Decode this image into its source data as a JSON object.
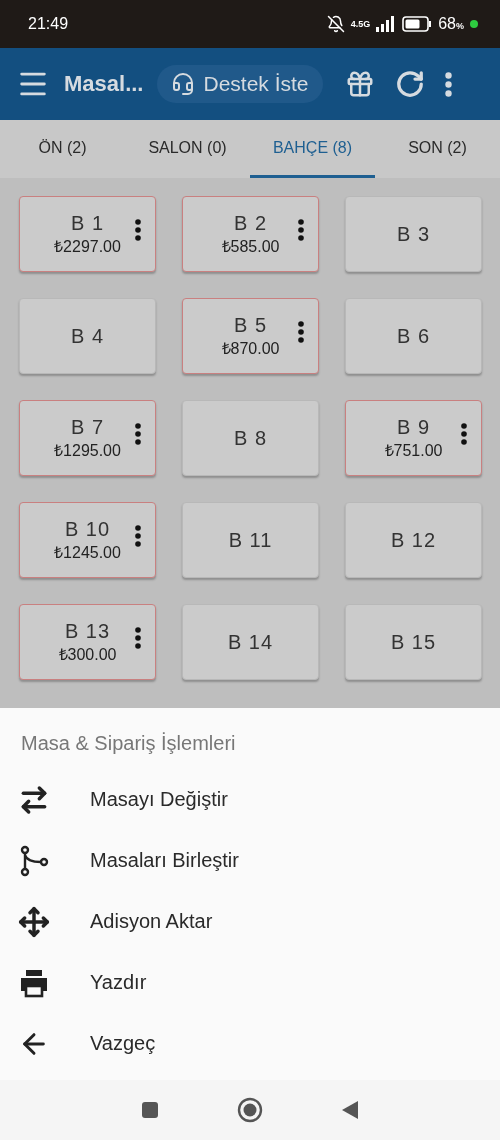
{
  "status_bar": {
    "time": "21:49",
    "network": "4.5G",
    "battery": "68",
    "battery_unit": "%"
  },
  "app_bar": {
    "title": "Masal...",
    "support_button": "Destek İste"
  },
  "tabs": [
    {
      "label": "ÖN (2)",
      "selected": false
    },
    {
      "label": "SALON (0)",
      "selected": false
    },
    {
      "label": "BAHÇE (8)",
      "selected": true
    },
    {
      "label": "SON (2)",
      "selected": false
    }
  ],
  "tables": [
    {
      "name": "B 1",
      "amount": "₺2297.00",
      "occupied": true
    },
    {
      "name": "B 2",
      "amount": "₺585.00",
      "occupied": true
    },
    {
      "name": "B 3",
      "occupied": false
    },
    {
      "name": "B 4",
      "occupied": false
    },
    {
      "name": "B 5",
      "amount": "₺870.00",
      "occupied": true
    },
    {
      "name": "B 6",
      "occupied": false
    },
    {
      "name": "B 7",
      "amount": "₺1295.00",
      "occupied": true
    },
    {
      "name": "B 8",
      "occupied": false
    },
    {
      "name": "B 9",
      "amount": "₺751.00",
      "occupied": true
    },
    {
      "name": "B 10",
      "amount": "₺1245.00",
      "occupied": true
    },
    {
      "name": "B 11",
      "occupied": false
    },
    {
      "name": "B 12",
      "occupied": false
    },
    {
      "name": "B 13",
      "amount": "₺300.00",
      "occupied": true
    },
    {
      "name": "B 14",
      "occupied": false
    },
    {
      "name": "B 15",
      "occupied": false
    }
  ],
  "sheet": {
    "title": "Masa & Sipariş İşlemleri",
    "items": [
      {
        "kind": "swap",
        "label": "Masayı Değiştir"
      },
      {
        "kind": "merge",
        "label": "Masaları Birleştir"
      },
      {
        "kind": "move",
        "label": "Adisyon Aktar"
      },
      {
        "kind": "print",
        "label": "Yazdır"
      },
      {
        "kind": "back",
        "label": "Vazgeç"
      }
    ]
  }
}
